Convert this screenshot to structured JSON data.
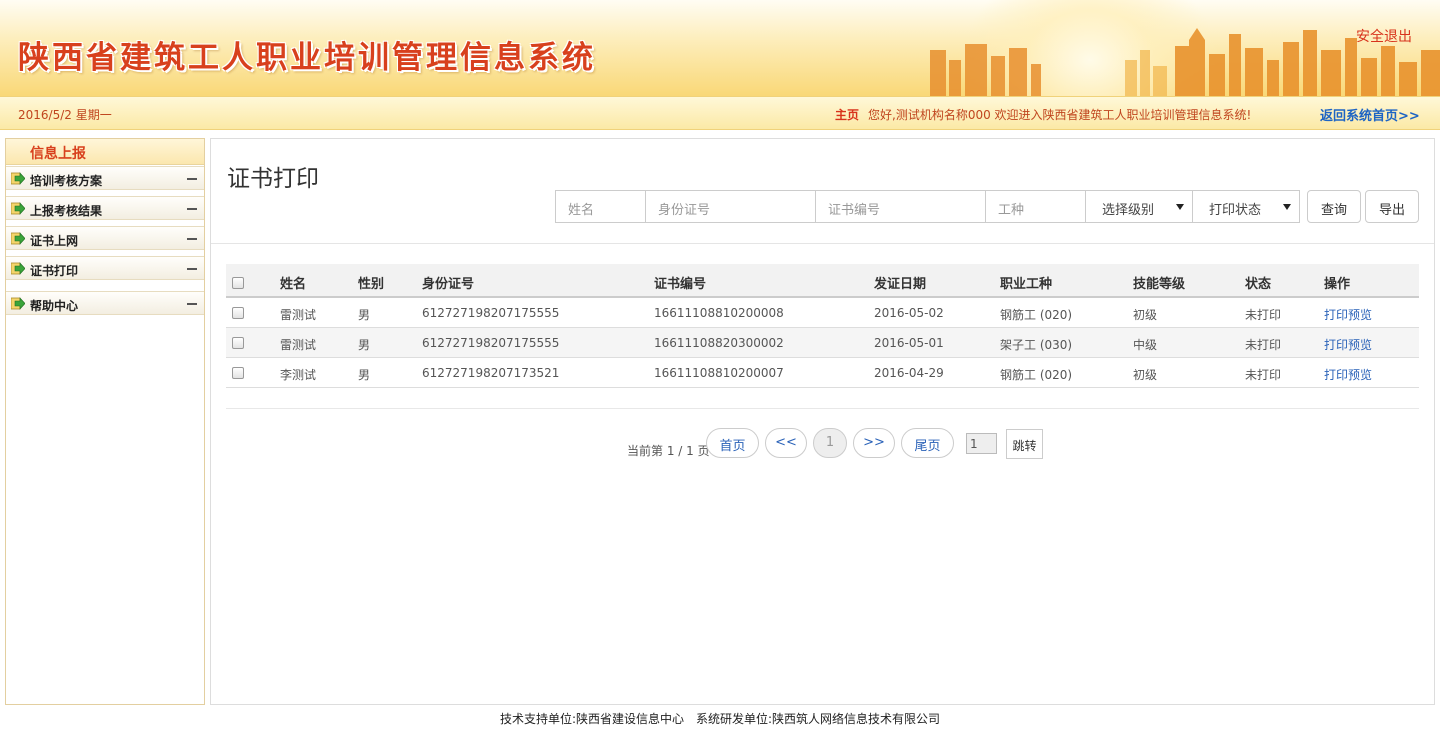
{
  "header": {
    "title": "陕西省建筑工人职业培训管理信息系统",
    "logout_label": "安全退出"
  },
  "subbar": {
    "date": "2016/5/2 星期一",
    "home_label": "主页",
    "welcome": "您好,测试机构名称000 欢迎进入陕西省建筑工人职业培训管理信息系统!",
    "back_label": "返回系统首页>>"
  },
  "sidebar": {
    "title": "信息上报",
    "items": [
      {
        "label": "培训考核方案"
      },
      {
        "label": "上报考核结果"
      },
      {
        "label": "证书上网"
      },
      {
        "label": "证书打印"
      },
      {
        "label": "帮助中心"
      }
    ]
  },
  "main": {
    "title": "证书打印",
    "filters": {
      "name_placeholder": "姓名",
      "id_placeholder": "身份证号",
      "cert_placeholder": "证书编号",
      "trade_placeholder": "工种",
      "level_select": "选择级别",
      "print_select": "打印状态"
    },
    "buttons": {
      "query": "查询",
      "export": "导出"
    }
  },
  "table": {
    "headers": [
      "姓名",
      "性别",
      "身份证号",
      "证书编号",
      "发证日期",
      "职业工种",
      "技能等级",
      "状态",
      "操作"
    ],
    "rows": [
      [
        "雷测试",
        "男",
        "612727198207175555",
        "16611108810200008",
        "2016-05-02",
        "钢筋工 (020)",
        "初级",
        "未打印",
        "打印预览"
      ],
      [
        "雷测试",
        "男",
        "612727198207175555",
        "16611108820300002",
        "2016-05-01",
        "架子工 (030)",
        "中级",
        "未打印",
        "打印预览"
      ],
      [
        "李测试",
        "男",
        "612727198207173521",
        "16611108810200007",
        "2016-04-29",
        "钢筋工 (020)",
        "初级",
        "未打印",
        "打印预览"
      ]
    ]
  },
  "pagination": {
    "info": "当前第 1 / 1 页",
    "first": "首页",
    "prev": "<<",
    "current": "1",
    "next": ">>",
    "last": "尾页",
    "input_value": "1",
    "go": "跳转"
  },
  "footer": {
    "support": "技术支持单位:陕西省建设信息中心",
    "developer": "系统研发单位:陕西筑人网络信息技术有限公司"
  }
}
